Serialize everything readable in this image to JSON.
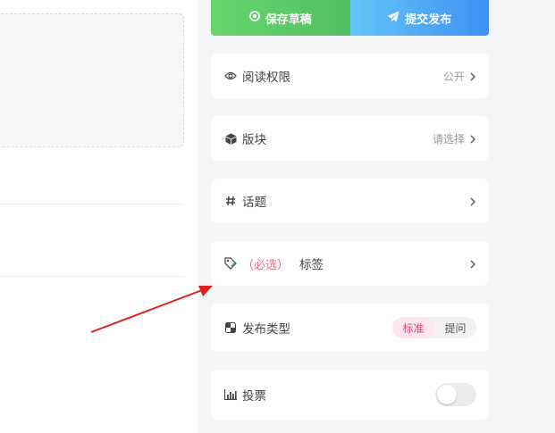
{
  "actions": {
    "draft_label": "保存草稿",
    "submit_label": "提交发布"
  },
  "settings": {
    "read_permission": {
      "label": "阅读权限",
      "value": "公开"
    },
    "section": {
      "label": "版块",
      "value": "请选择"
    },
    "topic": {
      "label": "话题"
    },
    "tags": {
      "required": "（必选）",
      "label": "标签"
    },
    "post_type": {
      "label": "发布类型",
      "options": [
        "标准",
        "提问"
      ],
      "selected": "标准"
    },
    "vote": {
      "label": "投票",
      "enabled": false
    }
  },
  "colors": {
    "draft": "#5ec766",
    "submit": "#4a9cf6",
    "required": "#ee6a7d",
    "arrow": "#e0201f"
  }
}
